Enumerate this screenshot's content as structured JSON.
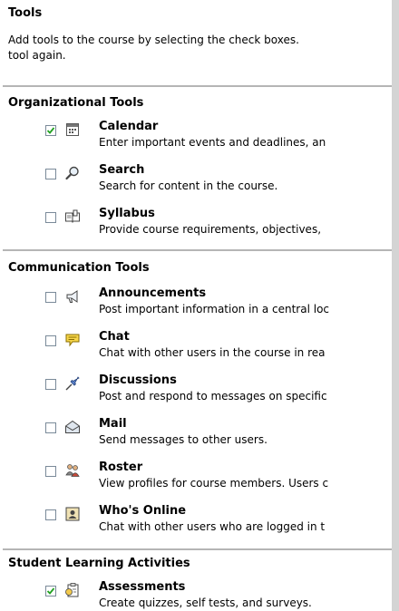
{
  "page": {
    "title": "Tools",
    "intro_line1": "Add tools to the course by selecting the check boxes.",
    "intro_line2": "tool again."
  },
  "sections": [
    {
      "title": "Organizational Tools",
      "tools": [
        {
          "name": "Calendar",
          "description": "Enter important events and deadlines, an",
          "checked": true,
          "icon": "calendar-icon"
        },
        {
          "name": "Search",
          "description": "Search for content in the course.",
          "checked": false,
          "icon": "magnifier-icon"
        },
        {
          "name": "Syllabus",
          "description": "Provide course requirements, objectives,",
          "checked": false,
          "icon": "book-icon"
        }
      ]
    },
    {
      "title": "Communication Tools",
      "tools": [
        {
          "name": "Announcements",
          "description": "Post important information in a central loc",
          "checked": false,
          "icon": "megaphone-icon"
        },
        {
          "name": "Chat",
          "description": "Chat with other users in the course in rea",
          "checked": false,
          "icon": "speech-bubble-icon"
        },
        {
          "name": "Discussions",
          "description": "Post and respond to messages on specific",
          "checked": false,
          "icon": "pushpin-icon"
        },
        {
          "name": "Mail",
          "description": "Send messages to other users.",
          "checked": false,
          "icon": "envelope-icon"
        },
        {
          "name": "Roster",
          "description": "View profiles for course members. Users c",
          "checked": false,
          "icon": "people-icon"
        },
        {
          "name": "Who's Online",
          "description": "Chat with other users who are logged in t",
          "checked": false,
          "icon": "online-users-icon"
        }
      ]
    },
    {
      "title": "Student Learning Activities",
      "tools": [
        {
          "name": "Assessments",
          "description": "Create quizzes, self tests, and surveys.",
          "checked": true,
          "icon": "assessment-icon"
        }
      ]
    }
  ],
  "colors": {
    "check_mark": "#21a121",
    "checkbox_border": "#7a8a99",
    "divider": "#b5b5b5",
    "frame": "#d4d4d4"
  }
}
